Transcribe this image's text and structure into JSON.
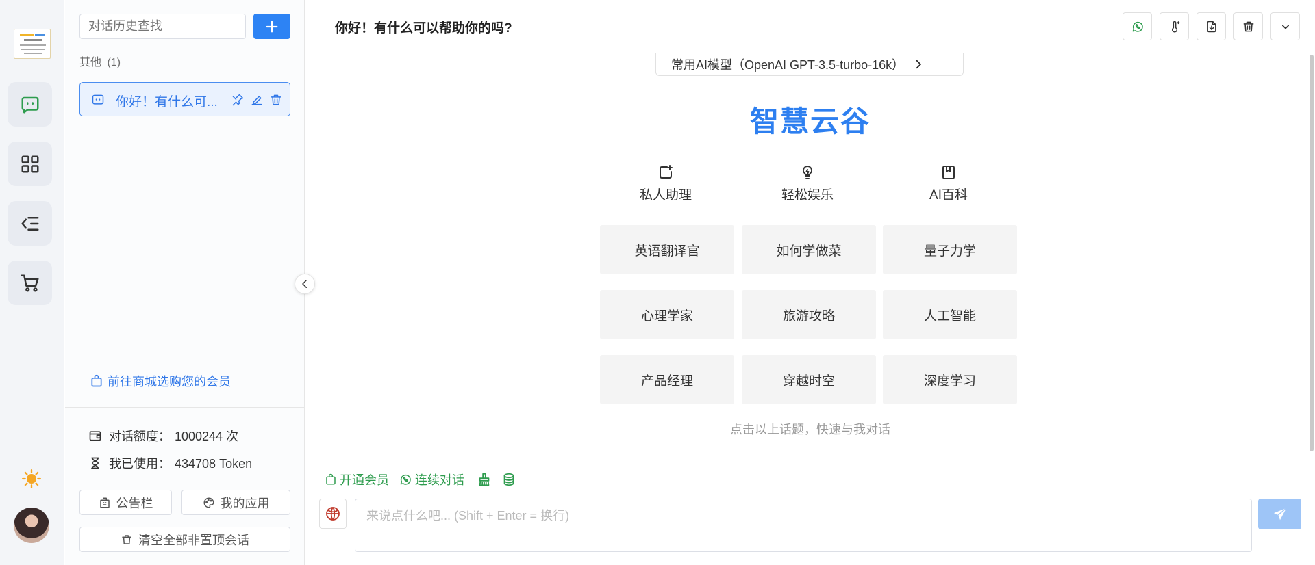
{
  "sidebar": {
    "search_placeholder": "对话历史查找",
    "group": {
      "name": "其他",
      "count": "(1)"
    },
    "conversations": [
      {
        "title": "你好！有什么可..."
      }
    ],
    "shop_link": "前往商城选购您的会员",
    "stats": {
      "quota_label": "对话额度：",
      "quota_value": "1000244 次",
      "used_label": "我已使用：",
      "used_value": "434708 Token"
    },
    "buttons": {
      "notice": "公告栏",
      "my_apps": "我的应用",
      "clear_all": "清空全部非置顶会话"
    }
  },
  "header": {
    "title": "你好！有什么可以帮助你的吗?"
  },
  "model": {
    "label": "常用AI模型（OpenAI GPT-3.5-turbo-16k）"
  },
  "welcome": {
    "brand": "智慧云谷",
    "categories": [
      {
        "label": "私人助理",
        "icon": "add-note-icon"
      },
      {
        "label": "轻松娱乐",
        "icon": "lightbulb-icon"
      },
      {
        "label": "AI百科",
        "icon": "book-icon"
      }
    ],
    "topics": [
      [
        "英语翻译官",
        "如何学做菜",
        "量子力学"
      ],
      [
        "心理学家",
        "旅游攻略",
        "人工智能"
      ],
      [
        "产品经理",
        "穿越时空",
        "深度学习"
      ]
    ],
    "hint": "点击以上话题，快速与我对话"
  },
  "composer": {
    "quick_actions": {
      "membership": "开通会员",
      "continuous": "连续对话"
    },
    "placeholder": "来说点什么吧... (Shift + Enter = 换行)"
  },
  "colors": {
    "accent": "#2d83f4",
    "brand": "#2d7ff0",
    "green": "#2e9c4e",
    "send_disabled": "#9ec5f7"
  }
}
